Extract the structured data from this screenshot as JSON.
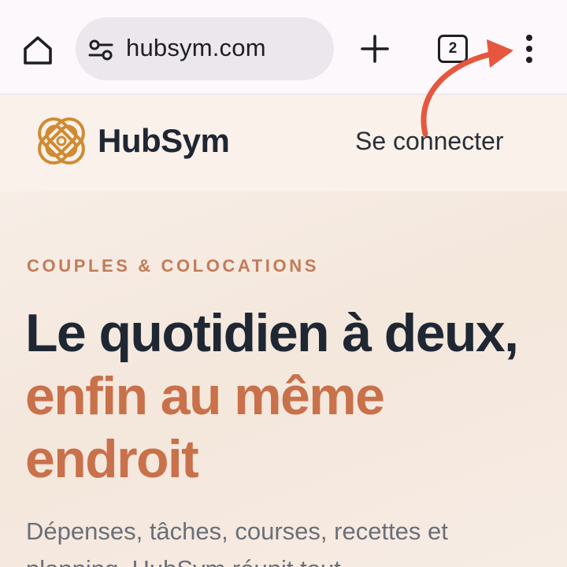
{
  "browser": {
    "url": "hubsym.com",
    "tab_count": "2",
    "icons": {
      "home": "home-icon",
      "site_settings": "tune-icon",
      "new_tab": "plus-icon",
      "menu": "more-vert-icon"
    }
  },
  "site": {
    "brand_name": "HubSym",
    "login_label": "Se connecter"
  },
  "hero": {
    "eyebrow": "COUPLES & COLOCATIONS",
    "title_main": "Le quotidien à deux, ",
    "title_accent": "enfin au même endroit",
    "subtitle": "Dépenses, tâches, courses, recettes et planning. HubSym réunit tout"
  },
  "annotation": {
    "arrow_color": "#e5573f",
    "points_to": "menu-button"
  },
  "colors": {
    "accent": "#c8714a",
    "eyebrow": "#c27b58",
    "heading": "#1f2733",
    "body_text": "#6a6f78",
    "logo": "#d08a32"
  }
}
